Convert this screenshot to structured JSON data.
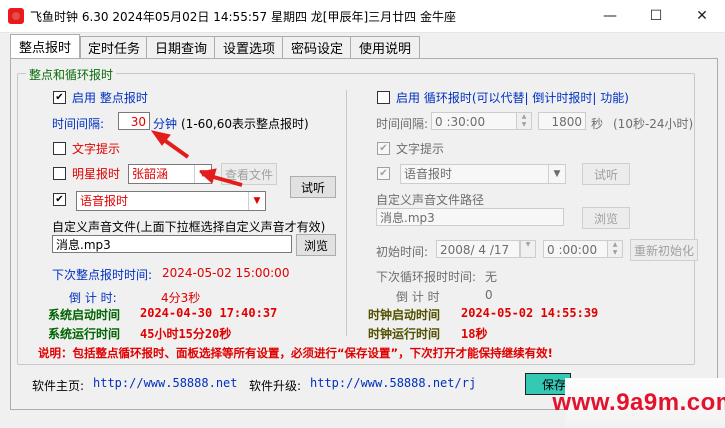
{
  "window": {
    "title": "飞鱼时钟 6.30 2024年05月02日 14:55:57 星期四 龙[甲辰年]三月廿四 金牛座",
    "minimize": "—",
    "maximize": "☐",
    "close": "✕"
  },
  "tabs": [
    "整点报时",
    "定时任务",
    "日期查询",
    "设置选项",
    "密码设定",
    "使用说明"
  ],
  "group_title": "整点和循环报时",
  "left": {
    "enable_label": "启用 整点报时",
    "interval_label": "时间间隔:",
    "interval_value": "30",
    "interval_unit": "分钟",
    "interval_hint": "(1-60,60表示整点报时)",
    "text_tip_label": "文字提示",
    "star_label": "明星报时",
    "star_select": "张韶涵",
    "view_file_btn": "查看文件",
    "voice_select": "语音报时",
    "listen_btn": "试听",
    "custom_file_label": "自定义声音文件(上面下拉框选择自定义声音才有效)",
    "custom_file_value": "消息.mp3",
    "browse_btn": "浏览",
    "next_label": "下次整点报时时间:",
    "next_value": "2024-05-02 15:00:00",
    "countdown_label": "倒 计 时:",
    "countdown_value": "4分3秒",
    "sys_start_label": "系统启动时间",
    "sys_start_value": "2024-04-30 17:40:37",
    "sys_run_label": "系统运行时间",
    "sys_run_value": "45小时15分20秒"
  },
  "right": {
    "enable_label": "启用 循环报时(可以代替| 倒计时报时| 功能)",
    "interval_label": "时间间隔:",
    "interval_value": "0 :30:00",
    "seconds_value": "1800",
    "seconds_unit": "秒",
    "seconds_hint": "(10秒-24小时)",
    "text_tip_label": "文字提示",
    "voice_select": "语音报时",
    "listen_btn": "试听",
    "custom_path_label": "自定义声音文件路径",
    "custom_file_value": "消息.mp3",
    "browse_btn": "浏览",
    "init_label": "初始时间:",
    "init_date": "2008/ 4 /17",
    "init_time": "0 :00:00",
    "reinit_btn": "重新初始化",
    "next_label": "下次循环报时时间:",
    "next_value": "无",
    "countdown_label": "倒 计 时",
    "countdown_value": "0",
    "clock_start_label": "时钟启动时间",
    "clock_start_value": "2024-05-02 14:55:39",
    "clock_run_label": "时钟运行时间",
    "clock_run_value": "18秒"
  },
  "note": "说明：包括整点循环报时、面板选择等所有设置，必须进行“保存设置”，下次打开才能保持继续有效!",
  "footer": {
    "homepage_label": "软件主页:",
    "homepage_url": "http://www.58888.net",
    "upgrade_label": "软件升级:",
    "upgrade_url": "http://www.58888.net/rj",
    "save_btn": "保存"
  },
  "watermark": "www.9a9m.com",
  "colors": {
    "accent_red": "#e00000",
    "label_blue": "#0030c0",
    "green": "#006400",
    "save": "#34c9b4"
  }
}
